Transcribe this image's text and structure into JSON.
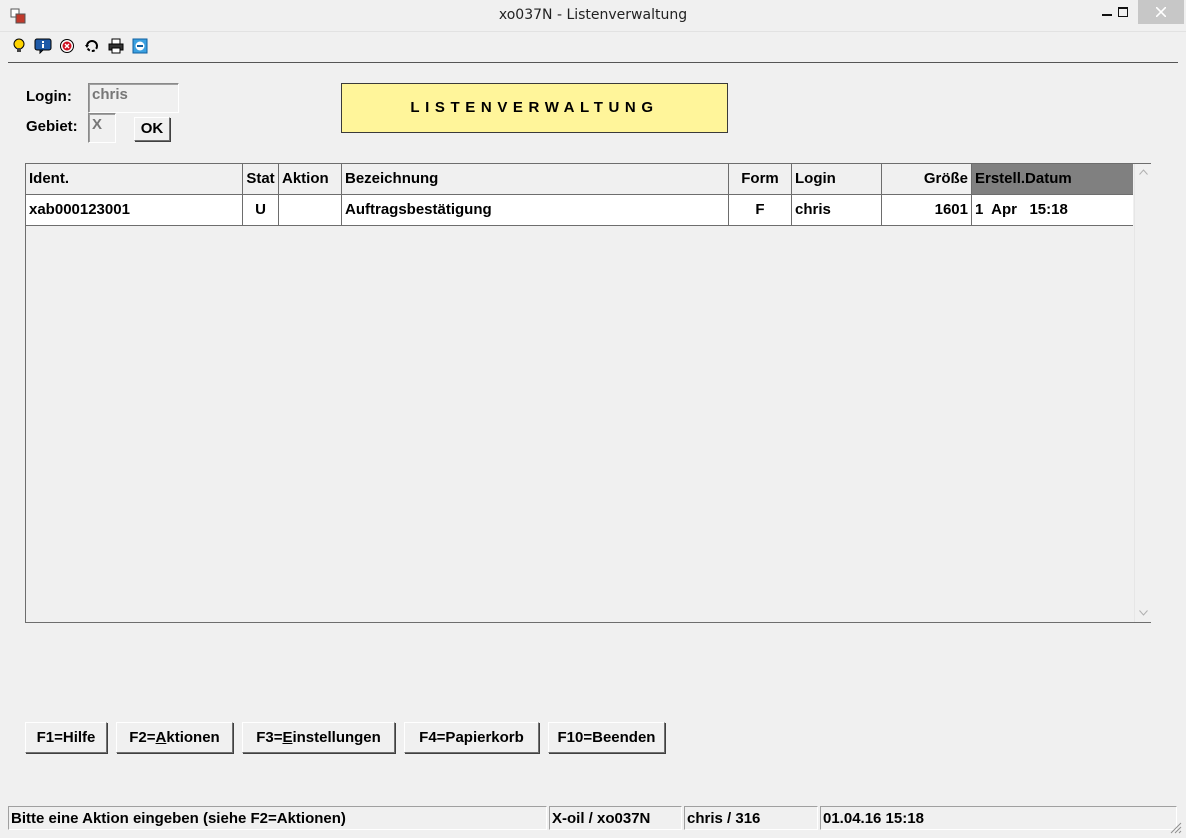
{
  "window": {
    "title": "xo037N - Listenverwaltung",
    "minimize_label": "▁",
    "maximize_label": "□",
    "close_label": "✕"
  },
  "toolbar": {
    "icons": [
      "lightbulb-icon",
      "info-icon",
      "cancel-icon",
      "refresh-icon",
      "printer-icon",
      "minus-icon"
    ]
  },
  "login": {
    "login_label": "Login:",
    "login_value": "chris",
    "gebiet_label": "Gebiet:",
    "gebiet_value": "X",
    "ok_label": "OK"
  },
  "banner": {
    "text": "LISTENVERWALTUNG"
  },
  "table": {
    "columns": {
      "ident": "Ident.",
      "stat": "Stat",
      "aktion": "Aktion",
      "bezeichnung": "Bezeichnung",
      "form": "Form",
      "login": "Login",
      "groesse": "Größe",
      "datum": "Erstell.Datum"
    },
    "rows": [
      {
        "ident": "xab000123001",
        "stat": "U",
        "aktion": "",
        "bezeichnung": "Auftragsbestätigung",
        "form": "F",
        "login": "chris",
        "groesse": "1601",
        "datum": "1  Apr   15:18"
      }
    ]
  },
  "function_keys": {
    "f1": "F1=Hilfe",
    "f2_prefix": "F2=",
    "f2_underlined": "A",
    "f2_rest": "ktionen",
    "f3_prefix": "F3=",
    "f3_underlined": "E",
    "f3_rest": "instellungen",
    "f4": "F4=Papierkorb",
    "f10": "F10=Beenden"
  },
  "statusbar": {
    "message": "Bitte eine Aktion eingeben (siehe F2=Aktionen)",
    "program": "X-oil / xo037N",
    "user": "chris / 316",
    "datetime": "01.04.16 15:18"
  },
  "colors": {
    "banner_bg": "#fff59a",
    "sorted_header_bg": "#808080",
    "window_bg": "#f0f0f0"
  }
}
